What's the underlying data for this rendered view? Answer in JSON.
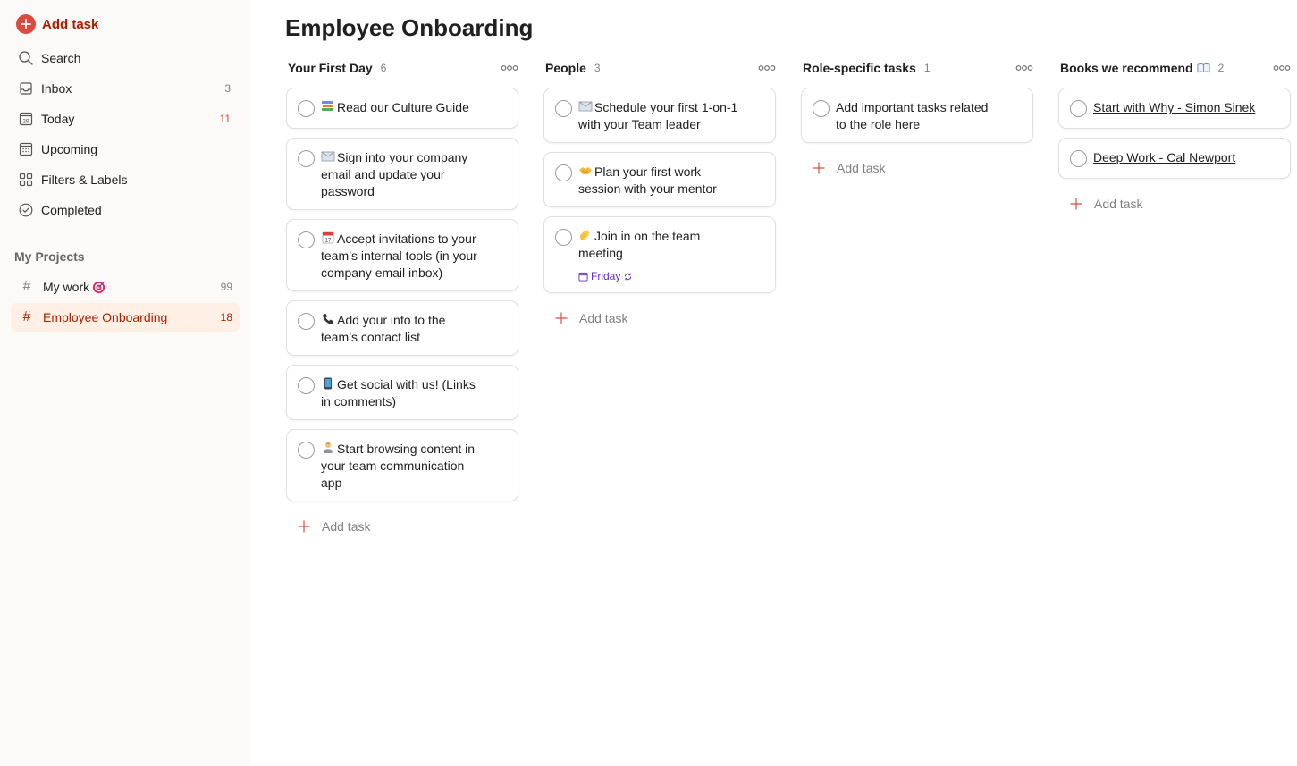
{
  "sidebar": {
    "add_task_label": "Add task",
    "nav": [
      {
        "label": "Search",
        "icon": "search-icon",
        "count": ""
      },
      {
        "label": "Inbox",
        "icon": "inbox-icon",
        "count": "3"
      },
      {
        "label": "Today",
        "icon": "calendar-today-icon",
        "count": "11"
      },
      {
        "label": "Upcoming",
        "icon": "calendar-upcoming-icon",
        "count": ""
      },
      {
        "label": "Filters & Labels",
        "icon": "grid-icon",
        "count": ""
      },
      {
        "label": "Completed",
        "icon": "check-circle-icon",
        "count": ""
      }
    ],
    "today_day_number": "29",
    "section_title": "My Projects",
    "projects": [
      {
        "label": "My work",
        "emoji": "target-emoji",
        "count": "99"
      },
      {
        "label": "Employee Onboarding",
        "count": "18",
        "active": true
      }
    ]
  },
  "page": {
    "title": "Employee Onboarding"
  },
  "board": {
    "columns": [
      {
        "name": "Your First Day",
        "count": "6",
        "tasks": [
          {
            "emoji": "books-emoji",
            "line1": "Read our Culture Guide",
            "line2": "",
            "line3": ""
          },
          {
            "emoji": "envelope-emoji",
            "line1": "Sign into your company",
            "line2": "email and update your",
            "line3": "password"
          },
          {
            "emoji": "calendar-emoji",
            "line1": "Accept invitations to your",
            "line2": "team’s internal tools (in your",
            "line3": "company email inbox)"
          },
          {
            "emoji": "phone-emoji",
            "line1": "Add your info to the",
            "line2": "team’s contact list",
            "line3": ""
          },
          {
            "emoji": "mobile-emoji",
            "line1": "Get social with us! (Links",
            "line2": "in comments)",
            "line3": ""
          },
          {
            "emoji": "person-laptop-emoji",
            "line1": "Start browsing content in",
            "line2": "your team communication",
            "line3": "app"
          }
        ],
        "add_label": "Add task"
      },
      {
        "name": "People",
        "count": "3",
        "tasks": [
          {
            "emoji": "envelope-emoji",
            "line1": "Schedule your first 1-on-1",
            "line2": "with your Team leader",
            "line3": ""
          },
          {
            "emoji": "handshake-emoji",
            "line1": "Plan your first work",
            "line2": "session with your mentor",
            "line3": ""
          },
          {
            "emoji": "wave-emoji",
            "line1": "Join in on the team",
            "line2": "meeting",
            "line3": "",
            "due": "Friday",
            "recurring": true
          }
        ],
        "add_label": "Add task"
      },
      {
        "name": "Role-specific tasks",
        "count": "1",
        "tasks": [
          {
            "emoji": "",
            "line1": "Add important tasks related",
            "line2": "to the role here",
            "line3": ""
          }
        ],
        "add_label": "Add task"
      },
      {
        "name": "Books we recommend",
        "name_emoji": "open-book-emoji",
        "count": "2",
        "tasks": [
          {
            "emoji": "",
            "line1": "Start with Why - Simon Sinek",
            "line2": "",
            "line3": "",
            "link": true
          },
          {
            "emoji": "",
            "line1": "Deep Work - Cal Newport",
            "line2": "",
            "line3": "",
            "link": true
          }
        ],
        "add_label": "Add task"
      }
    ]
  },
  "colors": {
    "accent": "#dc4c3e",
    "accent_dark": "#a81f00",
    "sidebar_bg": "#fcfaf8",
    "active_bg": "#ffefe5",
    "due_purple": "#692ec2"
  }
}
